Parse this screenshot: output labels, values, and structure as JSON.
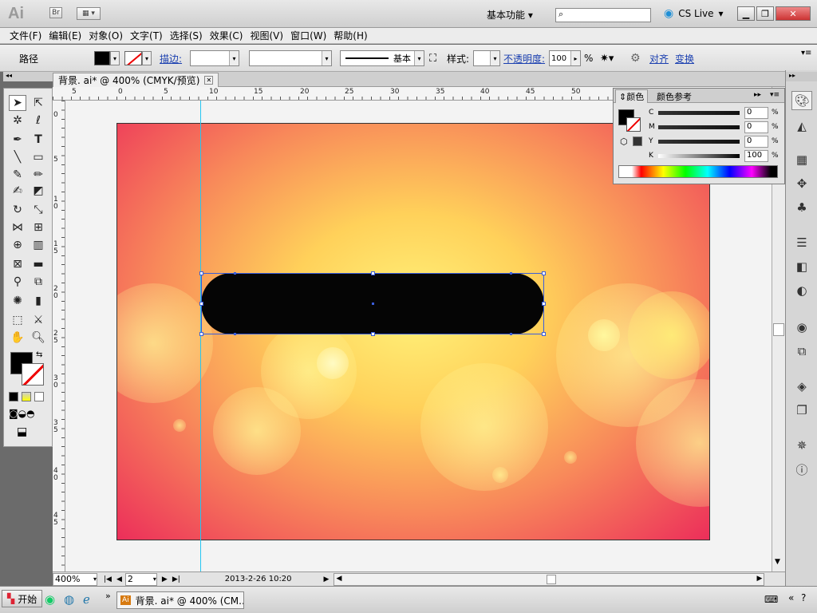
{
  "app": {
    "logo": "Ai",
    "bridge_label": "Br"
  },
  "titlebar": {
    "workspace": "基本功能",
    "cslive": "CS Live"
  },
  "menu": [
    "文件(F)",
    "编辑(E)",
    "对象(O)",
    "文字(T)",
    "选择(S)",
    "效果(C)",
    "视图(V)",
    "窗口(W)",
    "帮助(H)"
  ],
  "control": {
    "object_type": "路径",
    "stroke_label": "描边:",
    "stroke_style": "基本",
    "style_label": "样式:",
    "opacity_label": "不透明度:",
    "opacity_value": "100",
    "opacity_unit": "%",
    "align_label": "对齐",
    "transform_label": "变换"
  },
  "document": {
    "tab_title": "背景. ai* @ 400% (CMYK/预览)"
  },
  "ruler": {
    "top": [
      "5",
      "0",
      "5",
      "10",
      "15",
      "20",
      "25",
      "30",
      "35",
      "40",
      "45",
      "50"
    ],
    "left": [
      "0",
      "5",
      "1\n0",
      "1\n5",
      "2\n0",
      "2\n5",
      "3\n0",
      "3\n5",
      "4\n0",
      "4\n5"
    ]
  },
  "status": {
    "zoom": "400%",
    "page": "2",
    "datetime": "2013-2-26  10:20"
  },
  "color_panel": {
    "tab_color": "颜色",
    "tab_guide": "颜色参考",
    "channels": [
      {
        "label": "C",
        "value": "0",
        "unit": "%"
      },
      {
        "label": "M",
        "value": "0",
        "unit": "%"
      },
      {
        "label": "Y",
        "value": "0",
        "unit": "%"
      },
      {
        "label": "K",
        "value": "100",
        "unit": "%"
      }
    ]
  },
  "taskbar": {
    "start": "开始",
    "item": "背景. ai* @ 400% (CM..."
  },
  "colors": {
    "fill": "#000000",
    "guide": "#25c6f2",
    "selection": "#3a5dda"
  }
}
